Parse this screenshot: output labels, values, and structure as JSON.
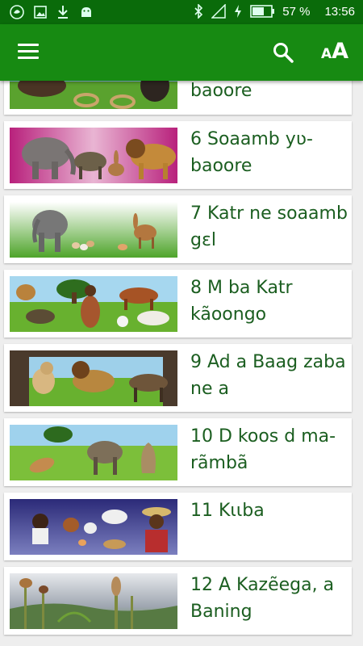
{
  "status_bar": {
    "battery": "57 %",
    "time": "13:56"
  },
  "toolbar": {
    "menu_icon": "hamburger-menu-icon",
    "search_icon": "search-icon",
    "text_size_small": "A",
    "text_size_big": "A"
  },
  "items": [
    {
      "title": "baoore",
      "theme": "rope-and-cattle"
    },
    {
      "title": "6 Soaamb yʋ-baoore",
      "theme": "elephant-hyena-hare-lion"
    },
    {
      "title": "7 Katr ne soaamb gɛl",
      "theme": "elephant-eggs-hare"
    },
    {
      "title": "8 M ba Katr kãoongo",
      "theme": "lion-hyena-woman-cow-sheep"
    },
    {
      "title": "9 Ad a Baag zaba ne a",
      "theme": "dog-lion-wild-dog"
    },
    {
      "title": "10 D koos d ma-rãmbã",
      "theme": "dog-hyena-sack"
    },
    {
      "title": "11 Kɩɩba",
      "theme": "boy-chickens-cow-man"
    },
    {
      "title": "12 A Kazẽega, a Baning",
      "theme": "sorghum-millet-field"
    }
  ]
}
